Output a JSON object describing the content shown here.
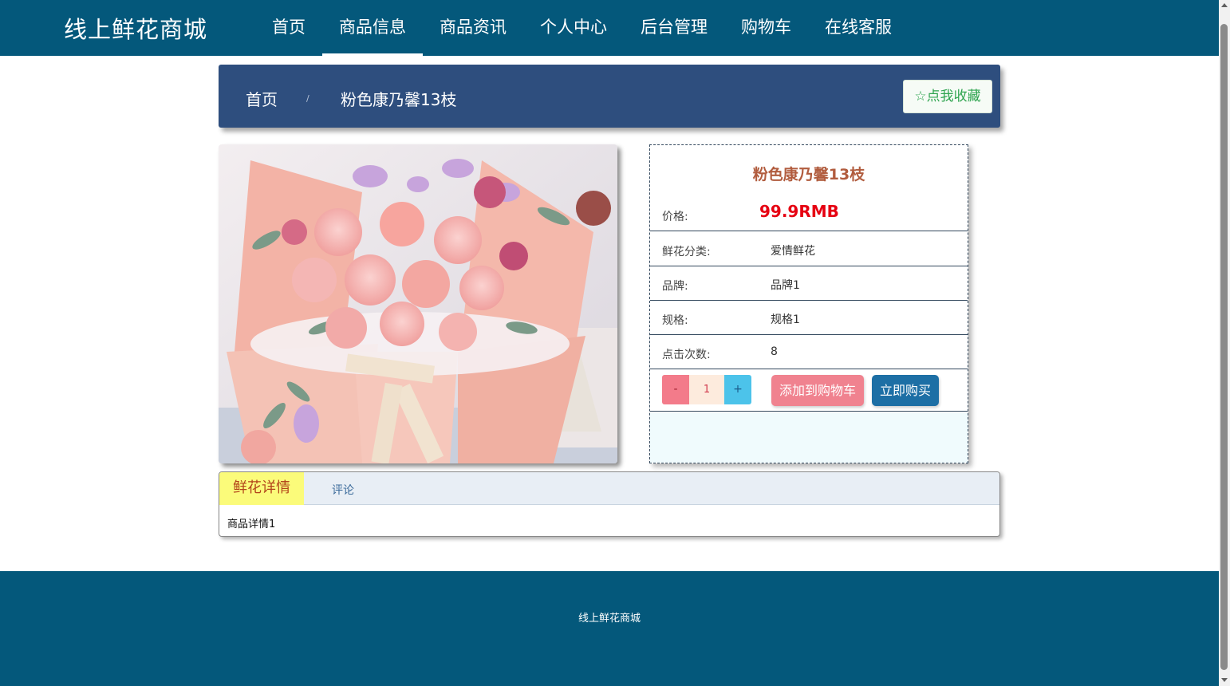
{
  "brand": "线上鲜花商城",
  "nav": {
    "items": [
      {
        "label": "首页"
      },
      {
        "label": "商品信息"
      },
      {
        "label": "商品资讯"
      },
      {
        "label": "个人中心"
      },
      {
        "label": "后台管理"
      },
      {
        "label": "购物车"
      },
      {
        "label": "在线客服"
      }
    ],
    "active_index": 1
  },
  "breadcrumb": {
    "home": "首页",
    "separator": "/",
    "current": "粉色康乃馨13枝"
  },
  "favorite_button": "点我收藏",
  "product": {
    "image_icon": "flower-bouquet-photo",
    "title": "粉色康乃馨13枝",
    "price_label": "价格:",
    "price": "99.9RMB",
    "fields": [
      {
        "label": "鲜花分类:",
        "value": "爱情鲜花"
      },
      {
        "label": "品牌:",
        "value": "品牌1"
      },
      {
        "label": "规格:",
        "value": "规格1"
      },
      {
        "label": "点击次数:",
        "value": "8"
      }
    ],
    "quantity": {
      "minus": "-",
      "value": "1",
      "plus": "+"
    },
    "add_to_cart": "添加到购物车",
    "buy_now": "立即购买"
  },
  "tabs": {
    "items": [
      {
        "label": "鲜花详情"
      },
      {
        "label": "评论"
      }
    ],
    "active_index": 0,
    "content": "商品详情1"
  },
  "footer": {
    "text": "线上鲜花商城"
  },
  "colors": {
    "header_bg": "#04587b",
    "breadcrumb_bg": "#2e4e7e",
    "price": "#e60012",
    "title": "#b15c3e",
    "cart_button": "#f0828f",
    "buy_button": "#1d6fa5",
    "active_tab": "#fbfb7a"
  }
}
